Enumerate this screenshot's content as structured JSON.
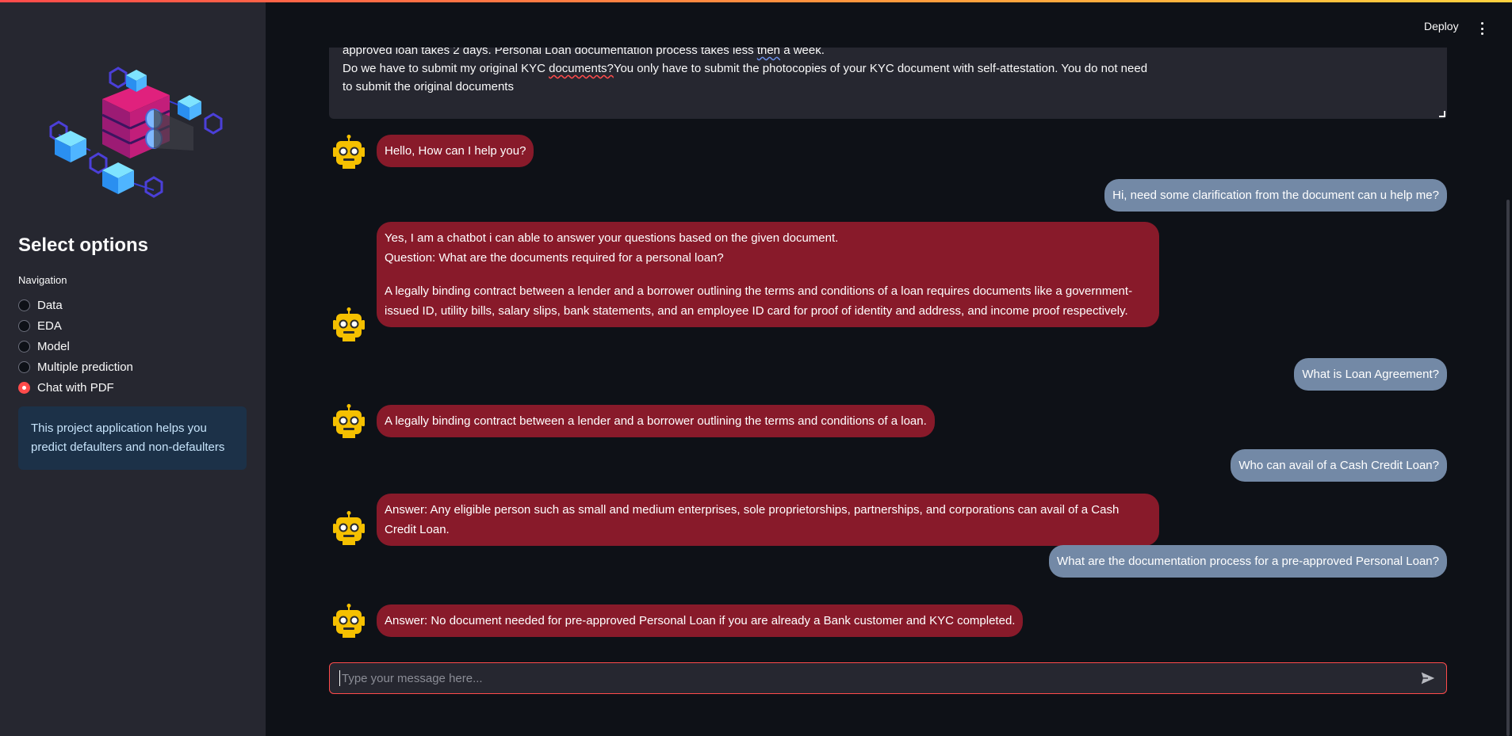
{
  "header": {
    "deploy_label": "Deploy"
  },
  "sidebar": {
    "logo_icon": "isometric-servers-cubes-icon",
    "title": "Select options",
    "nav_label": "Navigation",
    "options": [
      {
        "label": "Data",
        "selected": false
      },
      {
        "label": "EDA",
        "selected": false
      },
      {
        "label": "Model",
        "selected": false
      },
      {
        "label": "Multiple prediction",
        "selected": false
      },
      {
        "label": "Chat with PDF",
        "selected": true
      }
    ],
    "info": "This project application helps you predict defaulters and non-defaulters"
  },
  "document": {
    "line1": "approved loan takes 2 days. Personal Loan documentation process takes less then a week.",
    "line2": "Do we have to submit my original KYC documents?You only have to submit the photocopies of your KYC document with self-attestation. You do not need",
    "line3": "to submit the original documents"
  },
  "chat": {
    "bot_icon": "robot-face-icon",
    "m1": "Hello, How can I help you?",
    "m2": "Hi, need some clarification from the document can u help me?",
    "m3a": "Yes, I am a chatbot i can able to answer your questions based on the given document.",
    "m3b": "Question: What are the documents required for a personal loan?",
    "m3c": "A legally binding contract between a lender and a borrower outlining the terms and conditions of a loan requires documents like a government-issued ID, utility bills, salary slips, bank statements, and an employee ID card for proof of identity and address, and income proof respectively.",
    "m4": "What is Loan Agreement?",
    "m5": "A legally binding contract between a lender and a borrower outlining the terms and conditions of a loan.",
    "m6": "Who can avail of a Cash Credit Loan?",
    "m7": "Answer: Any eligible person such as small and medium enterprises, sole proprietorships, partnerships, and corporations can avail of a Cash Credit Loan.",
    "m8": "What are the documentation process for a pre-approved Personal Loan?",
    "m9": "Answer: No document needed for pre-approved Personal Loan if you are already a Bank customer and KYC completed."
  },
  "input": {
    "placeholder": "Type your message here...",
    "value": "",
    "send_icon": "send-icon"
  },
  "colors": {
    "accent": "#ff4b4b",
    "bot_bubble": "#881a2a",
    "user_bubble": "#7389a6",
    "background": "#0e1117",
    "sidebar": "#262730"
  }
}
